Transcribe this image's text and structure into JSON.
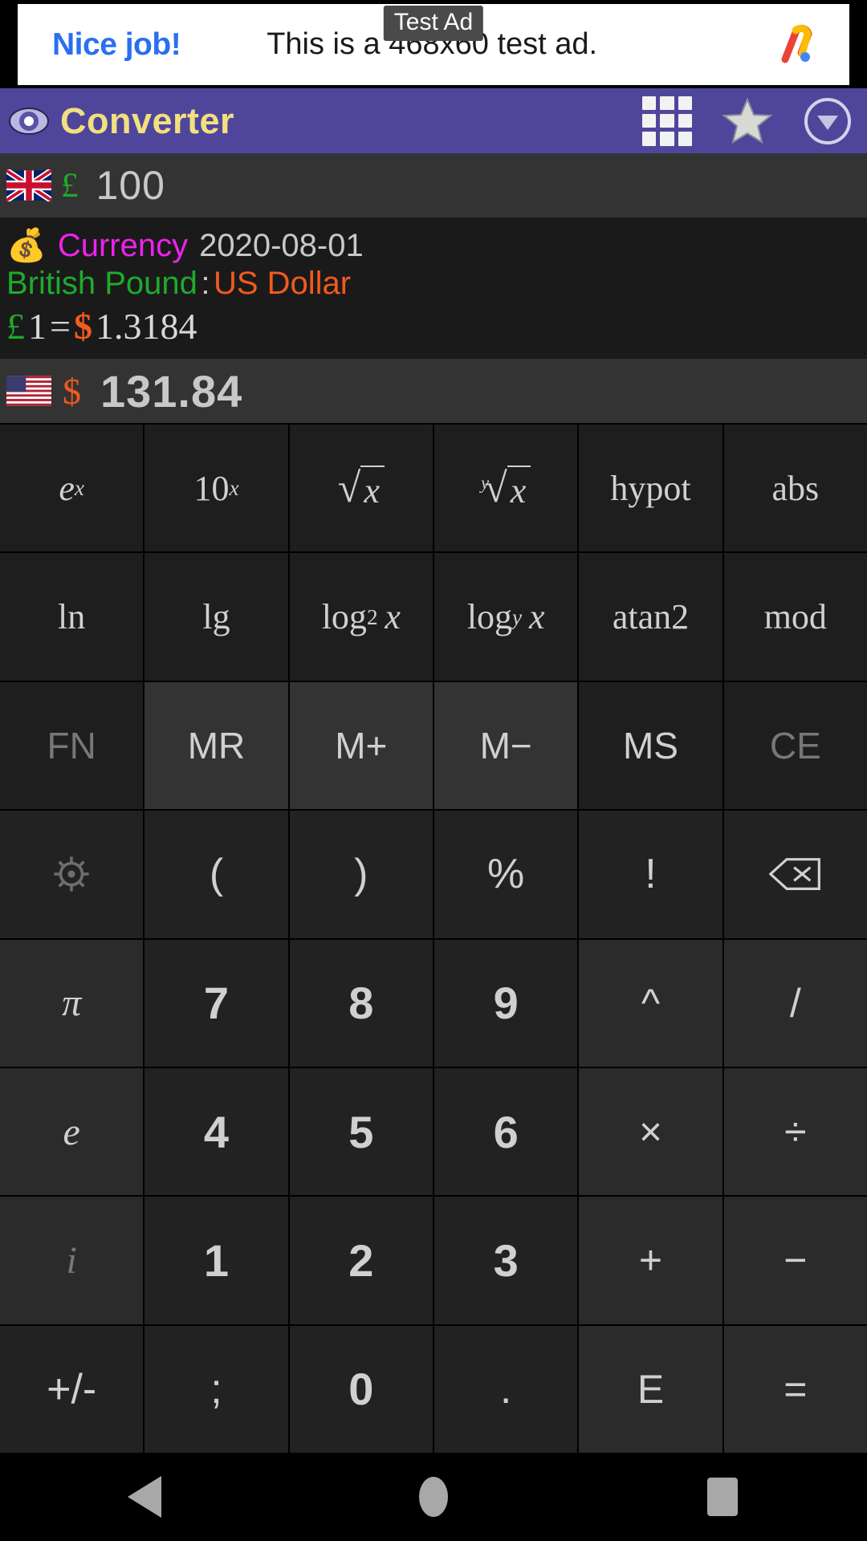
{
  "ad": {
    "badge": "Test Ad",
    "cta": "Nice job!",
    "text": "This is a 468x60 test ad.",
    "logo_icon": "admob-logo-icon"
  },
  "appbar": {
    "title": "Converter",
    "eye_icon": "eye-icon",
    "grid_icon": "grid-icon",
    "star_icon": "star-icon",
    "dropdown_icon": "chevron-down-circle-icon",
    "background": "#4f469c",
    "title_color": "#f2e07e"
  },
  "input_row": {
    "flag_icon": "uk-flag-icon",
    "symbol": "£",
    "symbol_color": "#1faa2c",
    "value": "100"
  },
  "info": {
    "bag_icon": "money-bag-icon",
    "category": "Currency",
    "category_color": "#ee22ee",
    "date": "2020-08-01",
    "from_name": "British Pound",
    "from_color": "#1faa2c",
    "separator": ":",
    "to_name": "US Dollar",
    "to_color": "#f15a1e",
    "rate_from_symbol": "£",
    "rate_from_amount": "1",
    "rate_equals": "=",
    "rate_to_symbol": "$",
    "rate_to_amount": "1.3184"
  },
  "result_row": {
    "flag_icon": "us-flag-icon",
    "symbol": "$",
    "symbol_color": "#f15a1e",
    "value": "131.84"
  },
  "keypad": {
    "rows": [
      [
        {
          "name": "key-e-pow-x",
          "label": "e^x",
          "style": "t-fn"
        },
        {
          "name": "key-10-pow-x",
          "label": "10^x",
          "style": "t-fn"
        },
        {
          "name": "key-sqrt-x",
          "label": "√x",
          "style": "t-fn"
        },
        {
          "name": "key-nth-root-x",
          "label": "y√x",
          "style": "t-fn"
        },
        {
          "name": "key-hypot",
          "label": "hypot",
          "style": "t-fn"
        },
        {
          "name": "key-abs",
          "label": "abs",
          "style": "t-fn"
        }
      ],
      [
        {
          "name": "key-ln",
          "label": "ln",
          "style": "t-fn"
        },
        {
          "name": "key-lg",
          "label": "lg",
          "style": "t-fn"
        },
        {
          "name": "key-log2x",
          "label": "log2 x",
          "style": "t-fn"
        },
        {
          "name": "key-logyx",
          "label": "logy x",
          "style": "t-fn"
        },
        {
          "name": "key-atan2",
          "label": "atan2",
          "style": "t-fn"
        },
        {
          "name": "key-mod",
          "label": "mod",
          "style": "t-fn"
        }
      ],
      [
        {
          "name": "key-fn",
          "label": "FN",
          "style": "t-memd t-dim"
        },
        {
          "name": "key-mr",
          "label": "MR",
          "style": "t-mem"
        },
        {
          "name": "key-m-plus",
          "label": "M+",
          "style": "t-mem"
        },
        {
          "name": "key-m-minus",
          "label": "M−",
          "style": "t-mem"
        },
        {
          "name": "key-ms",
          "label": "MS",
          "style": "t-memd"
        },
        {
          "name": "key-ce",
          "label": "CE",
          "style": "t-memd t-dim"
        }
      ],
      [
        {
          "name": "key-settings",
          "label": "gear-icon",
          "style": "t-sym",
          "icon": "gear"
        },
        {
          "name": "key-paren-open",
          "label": "(",
          "style": "t-sym"
        },
        {
          "name": "key-paren-close",
          "label": ")",
          "style": "t-sym"
        },
        {
          "name": "key-percent",
          "label": "%",
          "style": "t-sym"
        },
        {
          "name": "key-factorial",
          "label": "!",
          "style": "t-sym"
        },
        {
          "name": "key-backspace",
          "label": "backspace-icon",
          "style": "t-sym",
          "icon": "backspace"
        }
      ],
      [
        {
          "name": "key-pi",
          "label": "π",
          "style": "t-const"
        },
        {
          "name": "key-digit-7",
          "label": "7",
          "style": "t-num"
        },
        {
          "name": "key-digit-8",
          "label": "8",
          "style": "t-num"
        },
        {
          "name": "key-digit-9",
          "label": "9",
          "style": "t-num"
        },
        {
          "name": "key-power",
          "label": "^",
          "style": "t-op"
        },
        {
          "name": "key-slash",
          "label": "/",
          "style": "t-op"
        }
      ],
      [
        {
          "name": "key-euler-e",
          "label": "e",
          "style": "t-const"
        },
        {
          "name": "key-digit-4",
          "label": "4",
          "style": "t-num"
        },
        {
          "name": "key-digit-5",
          "label": "5",
          "style": "t-num"
        },
        {
          "name": "key-digit-6",
          "label": "6",
          "style": "t-num"
        },
        {
          "name": "key-multiply",
          "label": "×",
          "style": "t-op"
        },
        {
          "name": "key-divide",
          "label": "÷",
          "style": "t-op"
        }
      ],
      [
        {
          "name": "key-imaginary-i",
          "label": "i",
          "style": "t-const t-dim"
        },
        {
          "name": "key-digit-1",
          "label": "1",
          "style": "t-num"
        },
        {
          "name": "key-digit-2",
          "label": "2",
          "style": "t-num"
        },
        {
          "name": "key-digit-3",
          "label": "3",
          "style": "t-num"
        },
        {
          "name": "key-plus",
          "label": "+",
          "style": "t-op"
        },
        {
          "name": "key-minus",
          "label": "−",
          "style": "t-op"
        }
      ],
      [
        {
          "name": "key-sign-toggle",
          "label": "+/-",
          "style": "t-sym"
        },
        {
          "name": "key-semicolon",
          "label": ";",
          "style": "t-sym"
        },
        {
          "name": "key-digit-0",
          "label": "0",
          "style": "t-num"
        },
        {
          "name": "key-decimal",
          "label": ".",
          "style": "t-sym"
        },
        {
          "name": "key-exponent-E",
          "label": "E",
          "style": "t-eq"
        },
        {
          "name": "key-equals",
          "label": "=",
          "style": "t-eq"
        }
      ]
    ]
  },
  "navbar": {
    "back": "back-icon",
    "home": "home-icon",
    "recents": "recents-icon"
  }
}
